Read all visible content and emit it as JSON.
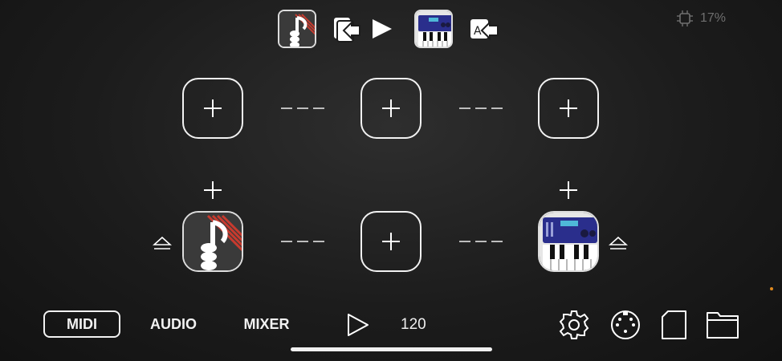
{
  "top_bar": {
    "midi_app_icon": "music-note-hand-icon",
    "send_to_icon": "route-arrow-icon",
    "play_icon": "play-icon",
    "synth_app_icon": "synth-keyboard-icon",
    "audio_route_icon": "audio-route-icon",
    "cpu": {
      "icon": "cpu-chip-icon",
      "value": "17%"
    }
  },
  "tabs": [
    {
      "label": "MIDI",
      "active": true
    },
    {
      "label": "AUDIO",
      "active": false
    },
    {
      "label": "MIXER",
      "active": false
    }
  ],
  "transport": {
    "play_icon": "play-icon",
    "tempo": "120"
  },
  "bottom_icons": [
    "gear-icon",
    "midi-port-icon",
    "document-icon",
    "folder-icon"
  ],
  "colors": {
    "accent": "#e08a1e",
    "slot_border": "#f2f2f2",
    "cpu_text": "#6f6f6f"
  }
}
